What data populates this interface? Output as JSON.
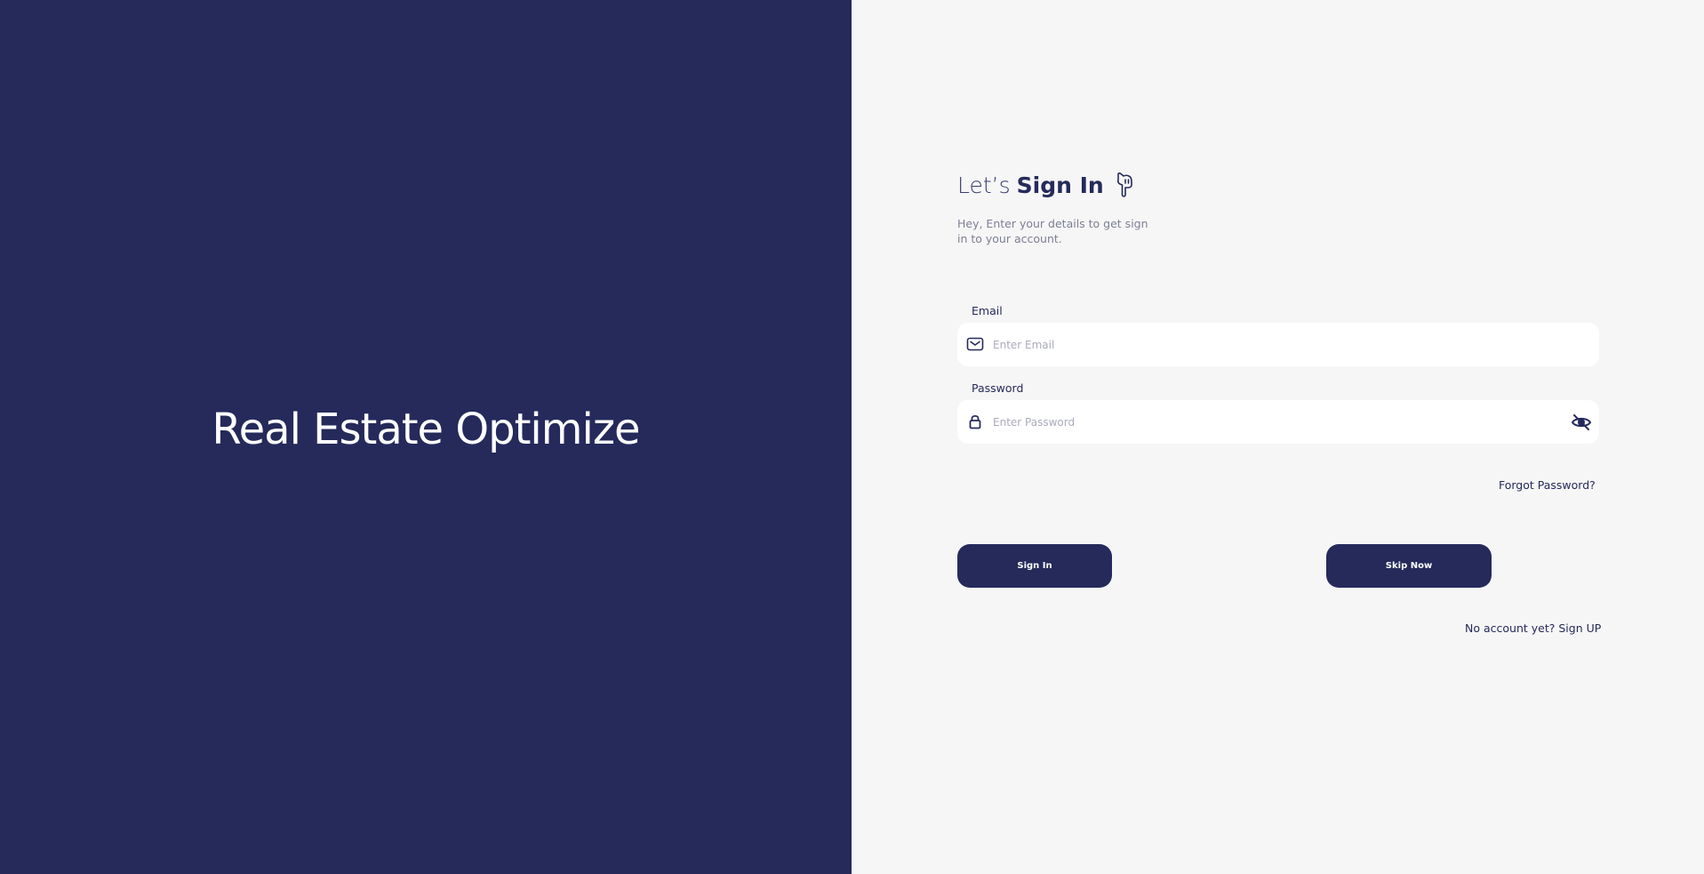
{
  "brand": {
    "title": "Real Estate Optimize"
  },
  "signin": {
    "heading_light": "Let’s",
    "heading_bold": "Sign In",
    "subtitle": "Hey, Enter your details to get sign in to your account."
  },
  "email": {
    "label": "Email",
    "placeholder": "Enter Email",
    "value": ""
  },
  "password": {
    "label": "Password",
    "placeholder": "Enter Password",
    "value": ""
  },
  "forgot_label": "Forgot Password?",
  "buttons": {
    "signin_label": "Sign In",
    "skip_label": "Skip Now"
  },
  "signup": {
    "prompt": "No account yet?",
    "link": "Sign UP"
  },
  "icons": {
    "hand": "pointing-down-hand-icon",
    "email": "envelope-icon",
    "password": "lock-icon",
    "visibility": "eye-off-icon"
  },
  "colors": {
    "primary": "#252a5b",
    "background": "#f6f6f6",
    "input": "#ffffff"
  }
}
